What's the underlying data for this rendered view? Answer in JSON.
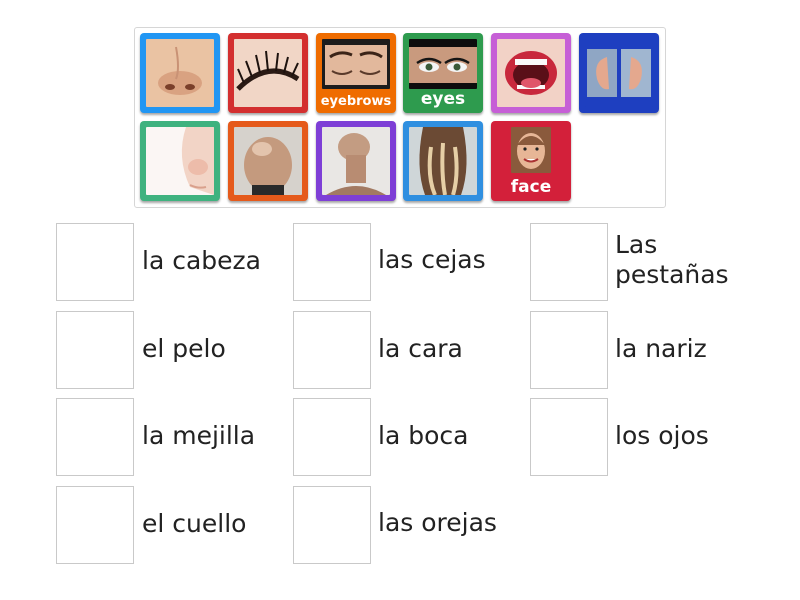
{
  "tiles": [
    {
      "icon": "nose-icon",
      "caption": "",
      "border": "#2196f3"
    },
    {
      "icon": "eyelashes-icon",
      "caption": "",
      "border": "#d32f2f"
    },
    {
      "icon": "eyebrows-icon",
      "caption": "eyebrows",
      "border": "#ef6c00"
    },
    {
      "icon": "eyes-icon",
      "caption": "eyes",
      "border": "#2e9b4e"
    },
    {
      "icon": "mouth-icon",
      "caption": "",
      "border": "#c65fd6"
    },
    {
      "icon": "ears-icon",
      "caption": "",
      "border": "#1e3fc0"
    },
    {
      "icon": "cheek-icon",
      "caption": "",
      "border": "#3fb27f"
    },
    {
      "icon": "head-icon",
      "caption": "",
      "border": "#e55a1b"
    },
    {
      "icon": "neck-icon",
      "caption": "",
      "border": "#7e3fd6"
    },
    {
      "icon": "hair-icon",
      "caption": "",
      "border": "#2f8fe0"
    },
    {
      "icon": "face-icon",
      "caption": "face",
      "border": "#d3203a"
    }
  ],
  "targets": [
    {
      "label": "la cabeza"
    },
    {
      "label": "las cejas"
    },
    {
      "label": "Las pestañas"
    },
    {
      "label": "el pelo"
    },
    {
      "label": "la cara"
    },
    {
      "label": "la nariz"
    },
    {
      "label": "la mejilla"
    },
    {
      "label": "la boca"
    },
    {
      "label": "los ojos"
    },
    {
      "label": "el cuello"
    },
    {
      "label": "las orejas"
    }
  ]
}
